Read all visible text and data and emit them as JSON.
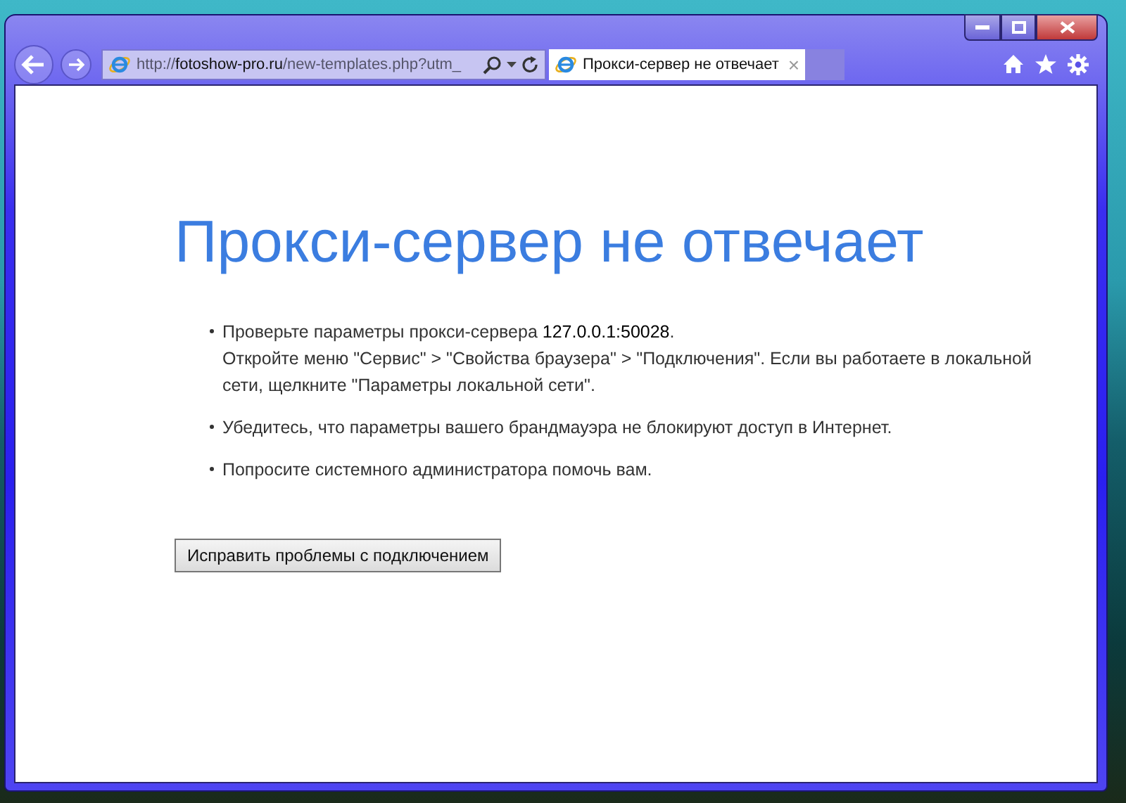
{
  "address_bar": {
    "url": "http://**fotoshow-pro.ru**/new-templates.php?utm_"
  },
  "tab": {
    "title": "Прокси-сервер не отвечает",
    "close": "×",
    "selected": true
  },
  "page": {
    "heading": "Прокси-сервер не отвечает",
    "bullets": [
      {
        "text": "Проверьте параметры прокси-сервера **127.0.0.1:50028**.",
        "detail": "Откройте меню \"Сервис\" > \"Свойства браузера\" > \"Подключения\". Если вы работаете в локальной сети, щелкните \"Параметры локальной сети\"."
      },
      {
        "text": "Убедитесь, что параметры вашего брандмауэра не блокируют доступ в Интернет."
      },
      {
        "text": "Попросите системного администратора помочь вам."
      }
    ],
    "button": "Исправить проблемы с подключением"
  }
}
